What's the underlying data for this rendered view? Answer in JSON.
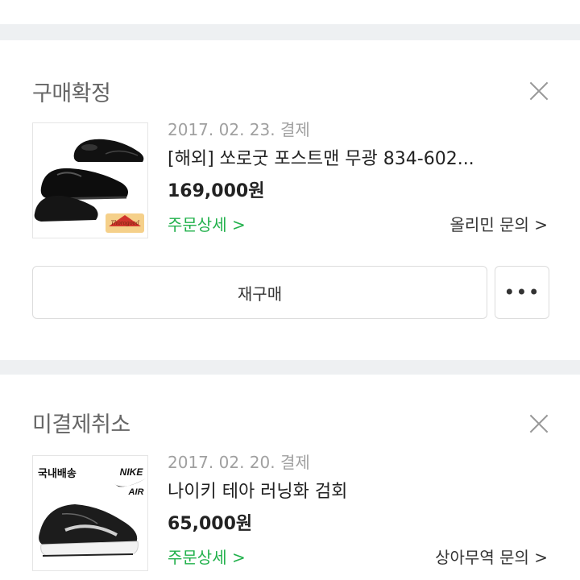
{
  "orders": [
    {
      "status": "구매확정",
      "date": "2017. 02. 23. 결제",
      "title": "[해외] 쏘로굿 포스트맨 무광 834-602...",
      "price": "169,000원",
      "detail_link": "주문상세 >",
      "inquiry_link": "올리민 문의 >",
      "rebuy_label": "재구매",
      "more_label": "•••",
      "thumb_badge": "Thorogood"
    },
    {
      "status": "미결제취소",
      "date": "2017. 02. 20. 결제",
      "title": "나이키 테아 러닝화 검회",
      "price": "65,000원",
      "detail_link": "주문상세 >",
      "inquiry_link": "상아무역 문의 >",
      "thumb_badge": "국내배송",
      "thumb_brand": "NIKE",
      "thumb_brand_sub": "AIR"
    }
  ]
}
